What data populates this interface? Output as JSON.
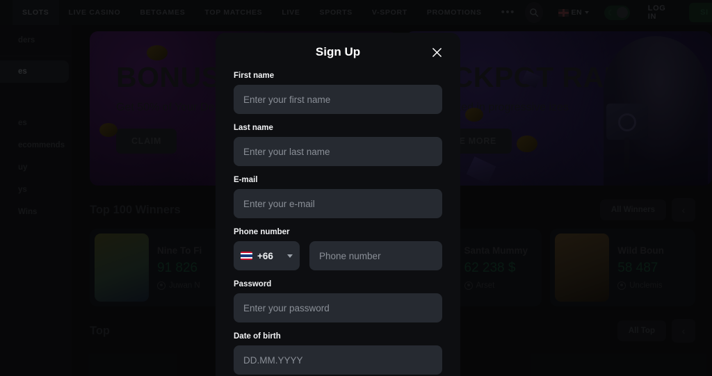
{
  "header": {
    "nav": [
      {
        "label": "SLOTS",
        "active": true
      },
      {
        "label": "LIVE CASINO",
        "active": false
      },
      {
        "label": "BETGAMES",
        "active": false
      },
      {
        "label": "TOP MATCHES",
        "active": false
      },
      {
        "label": "LIVE",
        "active": false
      },
      {
        "label": "SPORTS",
        "active": false
      },
      {
        "label": "V-SPORT",
        "active": false
      },
      {
        "label": "PROMOTIONS",
        "active": false
      }
    ],
    "more_label": "•••",
    "language": "EN",
    "login_label": "LOG IN",
    "signup_label": "SI",
    "icons": {
      "search": "search-icon",
      "theme": "moon-icon"
    }
  },
  "sidebar": {
    "items": [
      {
        "label": "ders",
        "active": false
      },
      {
        "label": "es",
        "active": true
      },
      {
        "label": "es",
        "active": false
      },
      {
        "label": "ecommends",
        "active": false
      },
      {
        "label": "uy",
        "active": false
      },
      {
        "label": "ys",
        "active": false
      },
      {
        "label": "Wins",
        "active": false
      }
    ]
  },
  "banners": [
    {
      "title": "BONUS",
      "subtitle": "Get 50% of Your De",
      "button": "CLAIM"
    },
    {
      "title": "ACKPOT RAIN",
      "subtitle": "t soaked in progressive izes",
      "button": "SEE MORE"
    }
  ],
  "winners": {
    "title": "Top 100 Winners",
    "all_label": "All Winners",
    "prev_icon": "chevron-left-icon",
    "cards": [
      {
        "game": "Nine To Fi",
        "amount": "91 826",
        "user": "Juwan N"
      },
      {
        "game": "",
        "amount": "",
        "user": ""
      },
      {
        "game": "Santa Mummy",
        "amount": "62 238 $",
        "user": "Arset"
      },
      {
        "game": "Wild Boun",
        "amount": "58 487",
        "user": "Unclemis"
      }
    ]
  },
  "top_section": {
    "title": "Top",
    "all_label": "All Top",
    "prev_icon": "chevron-left-icon"
  },
  "modal": {
    "title": "Sign Up",
    "close_icon": "close-icon",
    "fields": [
      {
        "label": "First name",
        "placeholder": "Enter your first name"
      },
      {
        "label": "Last name",
        "placeholder": "Enter your last name"
      },
      {
        "label": "E-mail",
        "placeholder": "Enter your e-mail"
      }
    ],
    "phone": {
      "label": "Phone number",
      "country_code": "+66",
      "flag": "thailand-flag-icon",
      "placeholder": "Phone number"
    },
    "password": {
      "label": "Password",
      "placeholder": "Enter your password"
    },
    "dob": {
      "label": "Date of birth",
      "placeholder": "DD.MM.YYYY"
    }
  },
  "colors": {
    "accent_green": "#1d3a2a",
    "modal_bg": "#0d0e11",
    "input_bg": "#262a31"
  }
}
